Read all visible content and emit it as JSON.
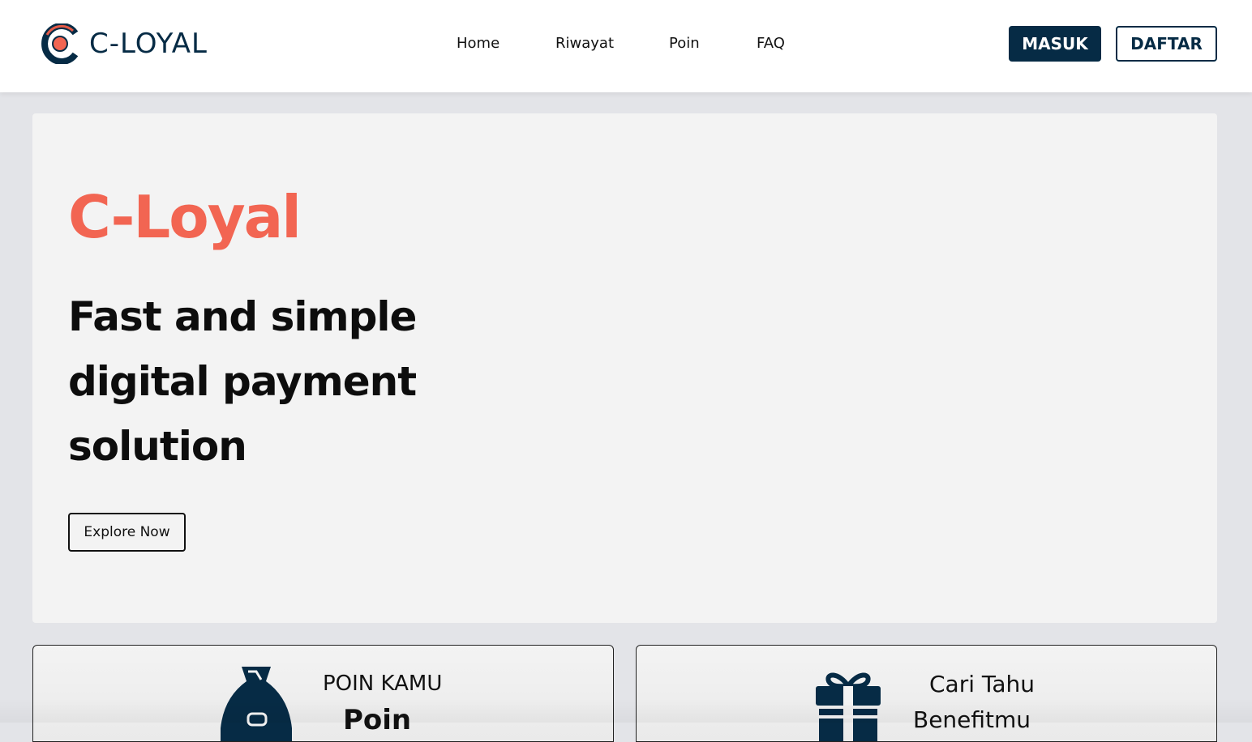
{
  "header": {
    "brand_name": "C-LOYAL",
    "nav": [
      "Home",
      "Riwayat",
      "Poin",
      "FAQ"
    ],
    "login_label": "MASUK",
    "register_label": "DAFTAR"
  },
  "hero": {
    "title": "C-Loyal",
    "subtitle": "Fast and simple digital payment solution",
    "cta_label": "Explore Now"
  },
  "cards": {
    "points": {
      "label": "POIN KAMU",
      "value": "Poin",
      "icon": "money-bag-icon"
    },
    "benefits": {
      "line1": "Cari Tahu",
      "line2": "Benefitmu",
      "icon": "gift-icon"
    }
  },
  "colors": {
    "brand_navy": "#062b45",
    "accent_coral": "#f26552",
    "page_bg": "#e3e4e8",
    "hero_bg": "#f3f3f3"
  }
}
